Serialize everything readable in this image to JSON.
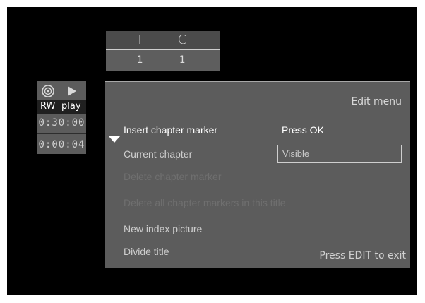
{
  "title_chapter": {
    "headers": [
      "T",
      "C"
    ],
    "values": [
      "1",
      "1"
    ]
  },
  "status": {
    "disc_icon": "disc-icon",
    "play_icon": "play-icon",
    "disc_label": "RW",
    "mode_label": "play",
    "total_time": "0:30:00",
    "current_time": "0:00:04"
  },
  "menu": {
    "title": "Edit menu",
    "items": [
      {
        "label": "Insert chapter marker",
        "state": "selected"
      },
      {
        "label": "Current chapter",
        "state": "normal"
      },
      {
        "label": "Delete chapter marker",
        "state": "disabled"
      },
      {
        "label": "Delete all chapter markers in this title",
        "state": "disabled"
      },
      {
        "label": "New index picture",
        "state": "normal"
      },
      {
        "label": "Divide title",
        "state": "normal"
      }
    ],
    "selected_action": "Press OK",
    "current_chapter_value": "Visible",
    "footer": "Press EDIT to exit"
  },
  "colors": {
    "background": "#000000",
    "panel": "#5c5c5c",
    "highlight_text": "#ffffff",
    "disabled_text": "#6f6f6f"
  }
}
